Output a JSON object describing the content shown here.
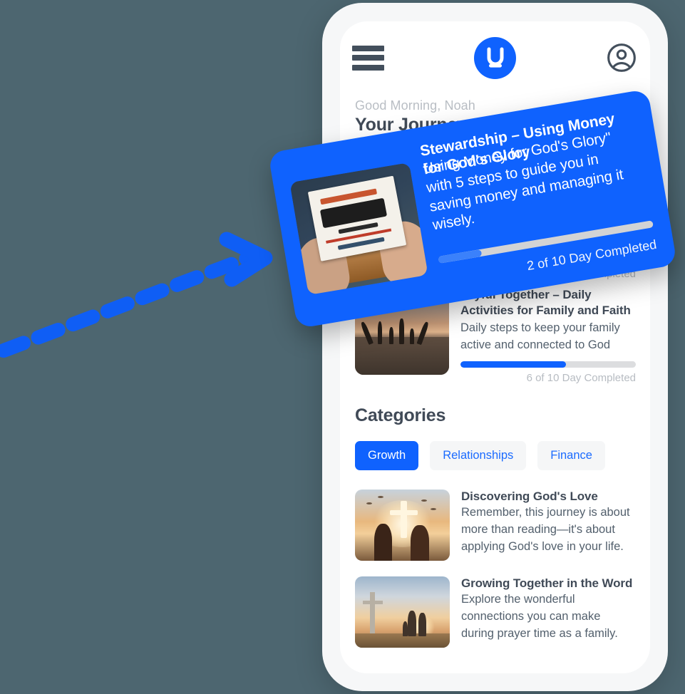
{
  "background_color": "#4d6670",
  "accent_color": "#0f62fe",
  "annotation": {
    "arrow_name": "dashed-pointer-arrow",
    "arrow_color": "#0f5ef5"
  },
  "header": {
    "menu_icon": "hamburger-menu-icon",
    "logo_letter": "U",
    "logo_name": "brand-logo-u",
    "account_icon": "account-circle-icon"
  },
  "greeting": {
    "salutation": "Good Morning, Noah",
    "title": "Your Journeys"
  },
  "journeys": [
    {
      "title": "Stewardship – Using Money for God's Glory",
      "description": "Using Money for God's Glory\" with 5 steps to guide you in saving money and managing it wisely.",
      "progress_label": "2 of 10 Day Completed",
      "progress_percent": 20,
      "thumb_name": "journey-thumb-stewardship",
      "highlighted": true
    },
    {
      "title": "Joyful Together – Daily Activities for Family and Faith",
      "description": "Daily steps to keep your family active and connected to God",
      "progress_label": "6 of 10 Day Completed",
      "progress_percent": 60,
      "thumb_name": "journey-thumb-joyful-together",
      "highlighted": false
    }
  ],
  "categories": {
    "title": "Categories",
    "chips": [
      {
        "label": "Growth",
        "active": true
      },
      {
        "label": "Relationships",
        "active": false
      },
      {
        "label": "Finance",
        "active": false
      }
    ],
    "items": [
      {
        "title": "Discovering God's Love",
        "description": "Remember, this journey is about more than reading—it's about applying God's love in your life.",
        "thumb_name": "category-thumb-discovering-gods-love"
      },
      {
        "title": "Growing Together in the Word",
        "description": "Explore the wonderful connections you can make during prayer time as a family.",
        "thumb_name": "category-thumb-growing-together-in-the-word"
      }
    ]
  }
}
